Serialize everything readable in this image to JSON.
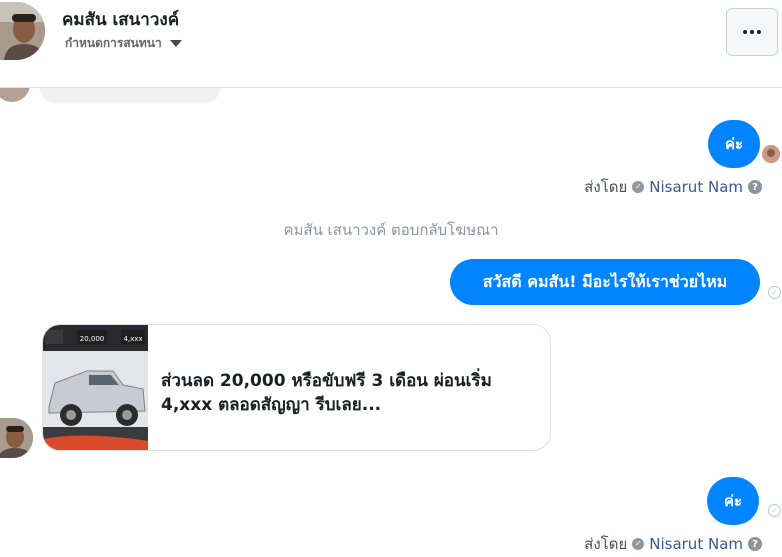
{
  "header": {
    "contact_name": "คมสัน เสนาวงค์",
    "settings_label": "กำหนดการสนทนา"
  },
  "messages": {
    "reply_1": "ค่ะ",
    "sent_by_prefix": "ส่งโดย",
    "sender_name": "Nisarut Nam",
    "system_note": "คมสัน เสนาวงค์ ตอบกลับโฆษณา",
    "greeting": "สวัสดี คมสัน! มีอะไรให้เราช่วยไหม",
    "ad_text": "ส่วนลด 20,000 หรือขับฟรี 3 เดือน ผ่อนเริ่ม 4,xxx ตลอดสัญญา รีบเลย...",
    "ad_tags": [
      "20,000",
      "4,xxx"
    ],
    "reply_2": "ค่ะ"
  },
  "colors": {
    "accent": "#0084ff",
    "sender": "#385898",
    "muted": "#90949c"
  },
  "icons": [
    "chevron-down-icon",
    "more-options-icon",
    "verified-check-icon",
    "help-icon",
    "delivered-check-icon"
  ]
}
